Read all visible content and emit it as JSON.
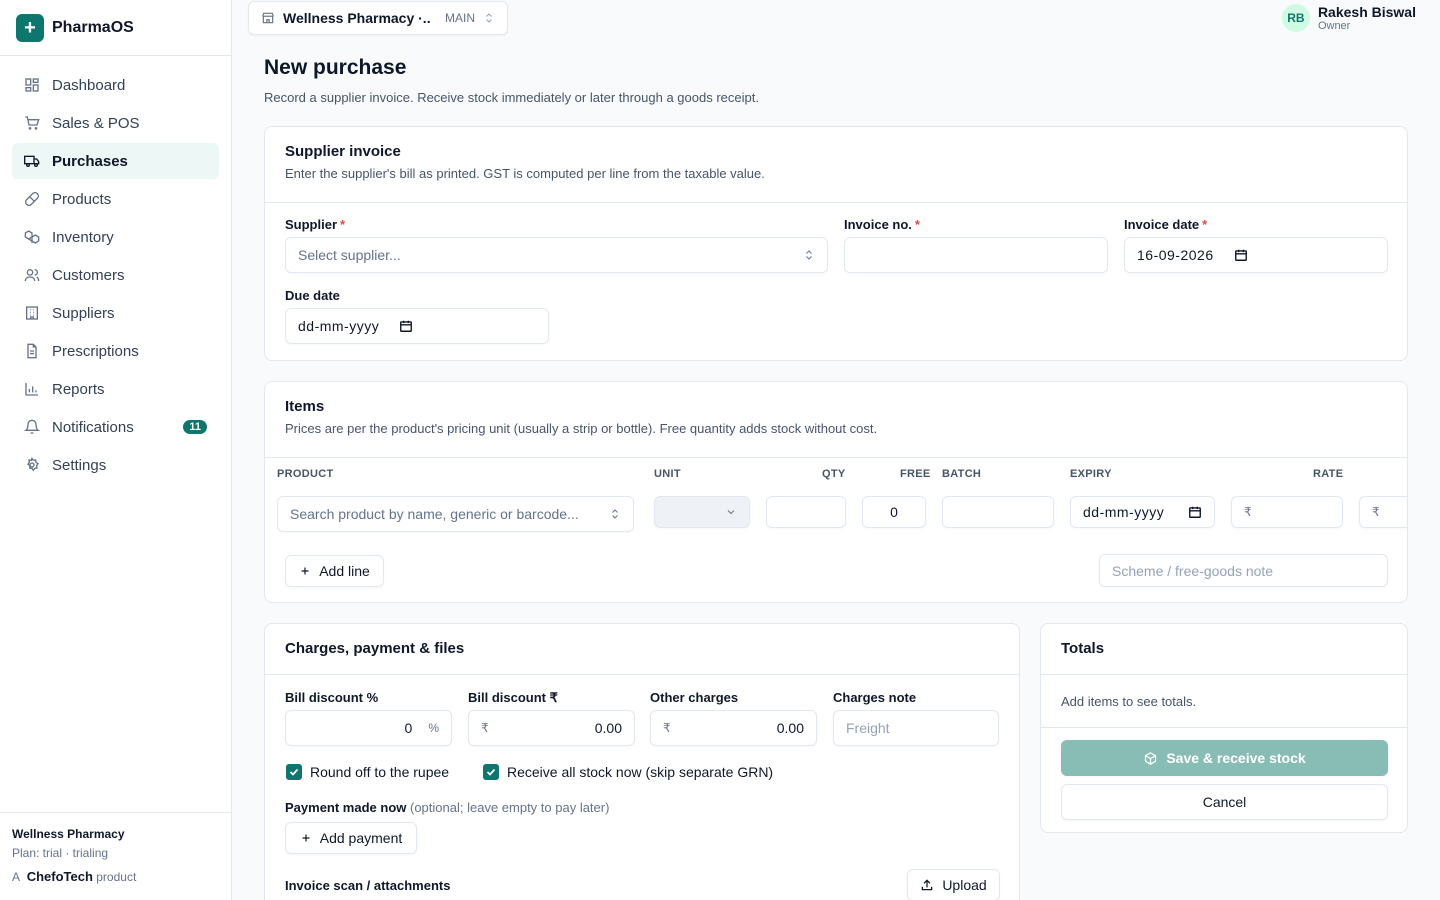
{
  "brand": {
    "name": "PharmaOS",
    "logo_glyph": "+"
  },
  "sidebar": {
    "items": [
      {
        "label": "Dashboard",
        "icon": "dashboard-icon"
      },
      {
        "label": "Sales & POS",
        "icon": "cart-icon"
      },
      {
        "label": "Purchases",
        "icon": "truck-icon",
        "active": true
      },
      {
        "label": "Products",
        "icon": "pill-icon"
      },
      {
        "label": "Inventory",
        "icon": "boxes-icon"
      },
      {
        "label": "Customers",
        "icon": "users-icon"
      },
      {
        "label": "Suppliers",
        "icon": "building-icon"
      },
      {
        "label": "Prescriptions",
        "icon": "file-icon"
      },
      {
        "label": "Reports",
        "icon": "bar-chart-icon"
      },
      {
        "label": "Notifications",
        "icon": "bell-icon",
        "badge": "11"
      },
      {
        "label": "Settings",
        "icon": "gear-icon"
      }
    ],
    "footer": {
      "org": "Wellness Pharmacy",
      "plan": "Plan: trial · trialing",
      "credit_prefix": "A",
      "credit_brand": "ChefoTech",
      "credit_suffix": "product"
    }
  },
  "topbar": {
    "store_name": "Wellness Pharmacy ·...",
    "store_tag": "MAIN",
    "user_initials": "RB",
    "user_name": "Rakesh Biswal",
    "user_role": "Owner"
  },
  "page": {
    "title": "New purchase",
    "subtitle": "Record a supplier invoice. Receive stock immediately or later through a goods receipt."
  },
  "supplier_invoice": {
    "title": "Supplier invoice",
    "desc": "Enter the supplier's bill as printed. GST is computed per line from the taxable value.",
    "supplier_label": "Supplier",
    "supplier_placeholder": "Select supplier...",
    "invoice_no_label": "Invoice no.",
    "invoice_no_value": "",
    "invoice_date_label": "Invoice date",
    "invoice_date_value": "16-09-2026",
    "due_date_label": "Due date",
    "due_date_placeholder": "dd-mm-yyyy",
    "required_mark": "*"
  },
  "items": {
    "title": "Items",
    "desc": "Prices are per the product's pricing unit (usually a strip or bottle). Free quantity adds stock without cost.",
    "columns": {
      "product": "PRODUCT",
      "unit": "UNIT",
      "qty": "QTY",
      "free": "FREE",
      "batch": "BATCH",
      "expiry": "EXPIRY",
      "rate": "RATE"
    },
    "row": {
      "product_placeholder": "Search product by name, generic or barcode...",
      "unit": "",
      "qty": "",
      "free": "0",
      "batch": "",
      "expiry_placeholder": "dd-mm-yyyy",
      "currency": "₹"
    },
    "add_line_label": "Add line",
    "scheme_placeholder": "Scheme / free-goods note"
  },
  "charges": {
    "title": "Charges, payment & files",
    "bill_discount_pct_label": "Bill discount %",
    "bill_discount_pct_value": "0",
    "pct_suffix": "%",
    "bill_discount_amt_label": "Bill discount ₹",
    "bill_discount_amt_value": "0.00",
    "other_charges_label": "Other charges",
    "other_charges_value": "0.00",
    "charges_note_label": "Charges note",
    "charges_note_placeholder": "Freight",
    "currency": "₹",
    "round_off_label": "Round off to the rupee",
    "round_off_checked": true,
    "receive_all_label": "Receive all stock now (skip separate GRN)",
    "receive_all_checked": true,
    "payment_label": "Payment made now",
    "payment_hint": "(optional; leave empty to pay later)",
    "add_payment_label": "Add payment",
    "attachments_label": "Invoice scan / attachments",
    "upload_label": "Upload"
  },
  "totals": {
    "title": "Totals",
    "empty_text": "Add items to see totals.",
    "save_label": "Save & receive stock",
    "cancel_label": "Cancel"
  }
}
